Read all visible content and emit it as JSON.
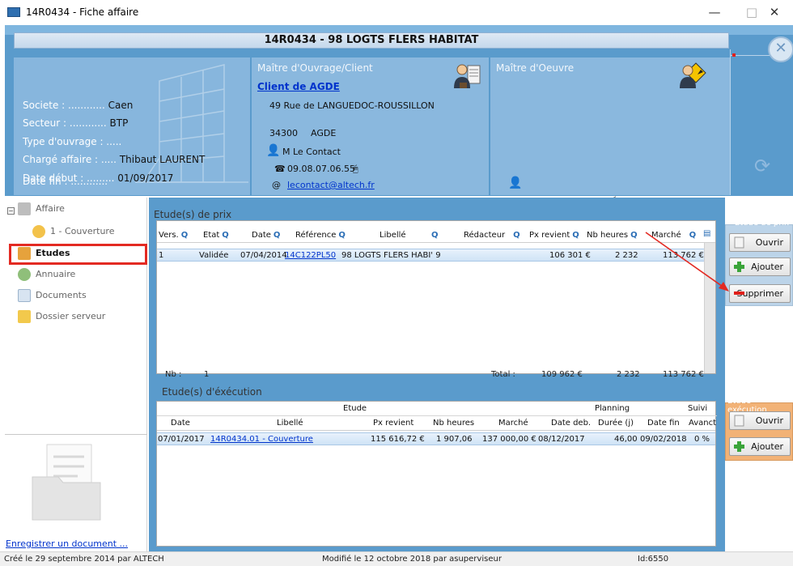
{
  "window": {
    "title": "14R0434 - Fiche affaire",
    "minimize_glyph": "—",
    "maximize_glyph": "□",
    "close_glyph": "✕"
  },
  "header": {
    "title": "14R0434 - 98 LOGTS FLERS HABITAT",
    "affaire": {
      "societe_label": "Societe : ............",
      "societe_value": "Caen",
      "secteur_label": "Secteur : ............",
      "secteur_value": "BTP",
      "type_label": "Type d'ouvrage : .....",
      "type_value": "",
      "charge_label": "Chargé affaire : .....",
      "charge_value": "Thibaut LAURENT",
      "date_debut_label": "Date début : .........",
      "date_debut_value": "01/09/2017",
      "date_fin_label": "Date fin : ............",
      "date_fin_value": ""
    },
    "maitre_ouvrage": {
      "title": "Maître d'Ouvrage/Client",
      "client_name": "Client de AGDE",
      "address1": "49 Rue de LANGUEDOC-ROUSSILLON",
      "postcode": "34300",
      "city": "AGDE",
      "contact": "M  Le Contact",
      "phone": "09.08.07.06.55",
      "email": "lecontact@altech.fr"
    },
    "maitre_oeuvre": {
      "title": "Maître d'Oeuvre",
      "at_glyph": "@"
    }
  },
  "nav": {
    "items": [
      {
        "label": "Affaire"
      },
      {
        "label": "1 - Couverture"
      },
      {
        "label": "Etudes"
      },
      {
        "label": "Annuaire"
      },
      {
        "label": "Documents"
      },
      {
        "label": "Dossier serveur"
      }
    ],
    "save_doc_link": "Enregistrer un document ..."
  },
  "etudes_prix": {
    "title": "Etude(s) de prix",
    "columns": [
      "Vers.",
      "Etat",
      "Date",
      "Référence",
      "Libellé",
      "Rédacteur",
      "Px revient",
      "Nb heures",
      "Marché"
    ],
    "rows": [
      {
        "vers": "1",
        "etat": "Validée",
        "date": "07/04/2014",
        "reference": "14C122PL50",
        "libelle": "98 LOGTS FLERS HABI' 9",
        "redacteur": "",
        "px_revient": "106 301 €",
        "nb_heures": "2 232",
        "marche": "113 762 €"
      }
    ],
    "nb_label": "Nb :",
    "nb_value": "1",
    "total_label": "Total :",
    "total_px": "109 962 €",
    "total_heures": "2 232",
    "total_marche": "113 762 €"
  },
  "etudes_exec": {
    "title": "Etude(s) d'éxécution",
    "group_etude": "Etude",
    "group_planning": "Planning",
    "group_suivi": "Suivi",
    "columns": [
      "Date",
      "Libellé",
      "Px revient",
      "Nb heures",
      "Marché",
      "Date deb.",
      "Durée (j)",
      "Date fin",
      "Avanct"
    ],
    "rows": [
      {
        "date": "07/01/2017",
        "libelle": "14R0434.01 - Couverture",
        "px_revient": "115 616,72 €",
        "nb_heures": "1 907,06",
        "marche": "137 000,00 €",
        "date_deb": "08/12/2017",
        "duree": "46,00",
        "date_fin": "09/02/2018",
        "avanct": "0 %"
      }
    ]
  },
  "side_prix": {
    "title": "Etude de prix",
    "open": "Ouvrir",
    "add": "Ajouter",
    "delete": "Supprimer"
  },
  "side_exec": {
    "title": "Etude exécution",
    "open": "Ouvrir",
    "add": "Ajouter"
  },
  "status": {
    "created": "Créé le 29 septembre 2014 par ALTECH",
    "modified": "Modifié le 12 octobre 2018 par asuperviseur",
    "id": "Id:6550"
  },
  "colors": {
    "accent_blue": "#5a9bcc",
    "highlight_red": "#e32a22",
    "exec_orange": "#f2b276"
  }
}
